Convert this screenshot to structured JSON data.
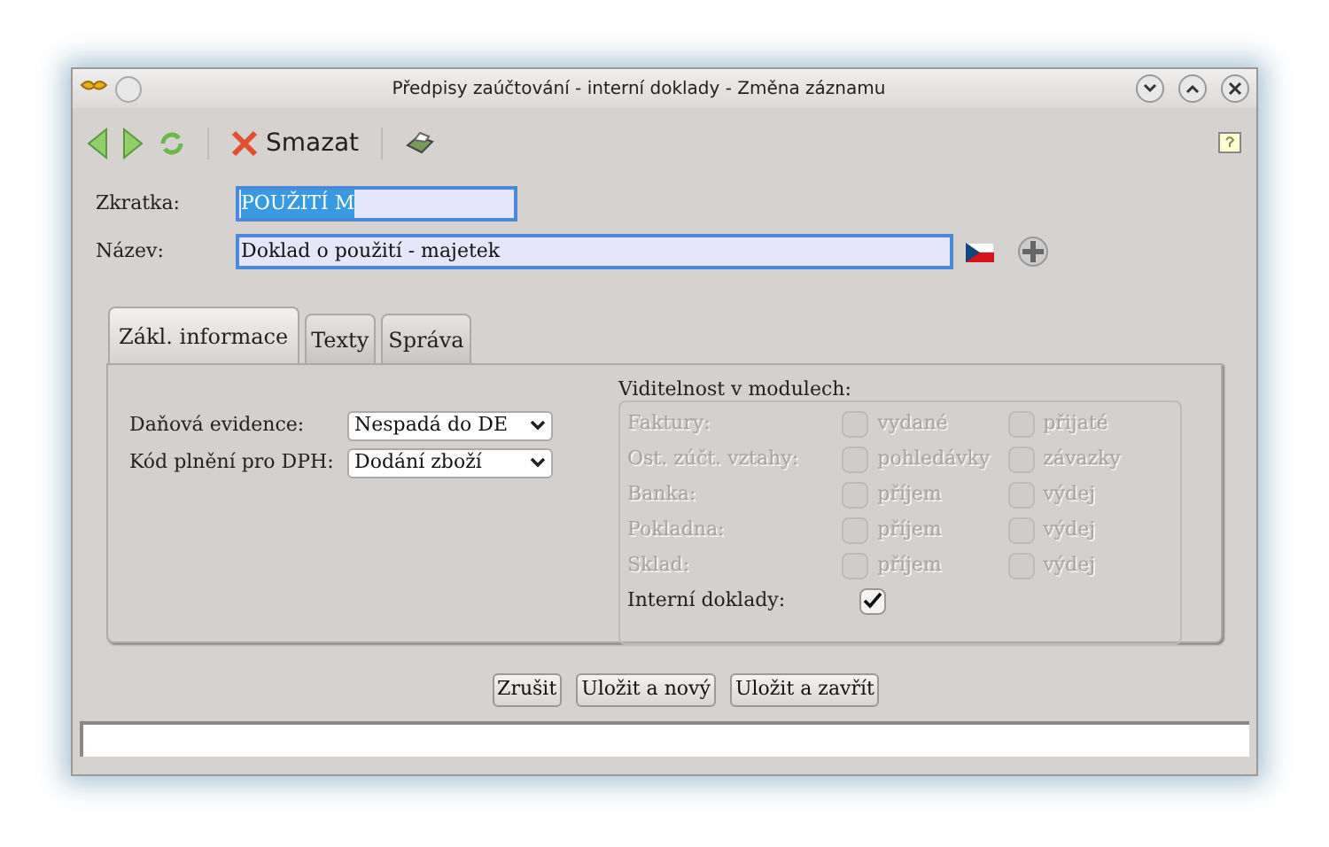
{
  "window": {
    "title": "Předpisy zaúčtování - interní doklady - Změna záznamu"
  },
  "toolbar": {
    "delete_label": "Smazat"
  },
  "fields": [
    {
      "label": "Zkratka:",
      "value": "POUŽITÍ M",
      "selected": true
    },
    {
      "label": "Název:",
      "value": "Doklad o použití - majetek",
      "selected": false
    }
  ],
  "tabs": [
    {
      "label": "Zákl. informace",
      "selected": true
    },
    {
      "label": "Texty",
      "selected": false
    },
    {
      "label": "Správa",
      "selected": false
    }
  ],
  "selects": [
    {
      "label": "Daňová evidence:",
      "value": "Nespadá do DE"
    },
    {
      "label": "Kód plnění pro DPH:",
      "value": "Dodání zboží"
    }
  ],
  "visibility": {
    "title": "Viditelnost v modulech:",
    "rows": [
      {
        "label": "Faktury:",
        "disabled": true,
        "options": [
          {
            "label": "vydané",
            "checked": false
          },
          {
            "label": "přijaté",
            "checked": false
          }
        ]
      },
      {
        "label": "Ost. zúčt. vztahy:",
        "disabled": true,
        "options": [
          {
            "label": "pohledávky",
            "checked": false
          },
          {
            "label": "závazky",
            "checked": false
          }
        ]
      },
      {
        "label": "Banka:",
        "disabled": true,
        "options": [
          {
            "label": "příjem",
            "checked": false
          },
          {
            "label": "výdej",
            "checked": false
          }
        ]
      },
      {
        "label": "Pokladna:",
        "disabled": true,
        "options": [
          {
            "label": "příjem",
            "checked": false
          },
          {
            "label": "výdej",
            "checked": false
          }
        ]
      },
      {
        "label": "Sklad:",
        "disabled": true,
        "options": [
          {
            "label": "příjem",
            "checked": false
          },
          {
            "label": "výdej",
            "checked": false
          }
        ]
      },
      {
        "label": "Interní doklady:",
        "disabled": false,
        "options": [
          {
            "checked": true
          }
        ]
      }
    ]
  },
  "buttons": [
    "Zrušit",
    "Uložit a nový",
    "Uložit a zavřít"
  ]
}
